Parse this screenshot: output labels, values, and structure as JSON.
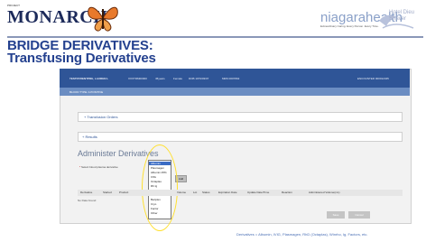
{
  "header": {
    "logo_sub": "PROJECT",
    "logo": "MONARCH",
    "partner": "niagarahealth",
    "partner_tagline": "Extraordinary Caring. Every Person. Every Time.",
    "partner2_line1": "Hotel Dieu",
    "partner2_line2": "Shaver"
  },
  "slide": {
    "title_line1": "BRIDGE DERIVATIVES:",
    "title_line2": "Transfusing Derivatives"
  },
  "patient_bar": {
    "name": "TESTPATIENTPRE, LAUREN L",
    "fields": [
      "XXXTRM00000",
      "45years",
      "Female",
      "DOB 1979/03/07",
      "MRN 0007802"
    ],
    "right": "ENCOUNTER 000012345"
  },
  "subbar": {
    "text": "BLOOD TYPE: A POSITIVE"
  },
  "sections": {
    "transfusion_orders": "+ Transfusion Orders",
    "results": "+ Results"
  },
  "admin": {
    "title": "Administer Derivatives",
    "select_label": "Select blood plasma derivative",
    "add_button": "Add",
    "options": [
      "Albumin",
      "Plasmagen",
      "Albumin 25%",
      "IVIG",
      "Octaplas",
      "Rh Ig",
      "Winrho",
      "Kcentra",
      "Beriplex",
      "Cryo",
      "Factor",
      "Other"
    ],
    "selected_index": 0
  },
  "table": {
    "columns": [
      "Derivative",
      "Started",
      "Product",
      "Volume",
      "Lot",
      "Status",
      "Expiration Date",
      "Update Date/Time",
      "Reaction",
      "Administered Volume(mL)"
    ],
    "empty_text": "No Data Found"
  },
  "footer_buttons": [
    "Save",
    "Cancel"
  ],
  "footer": {
    "text": "Derivatives = Albumin, IVIG, Plasmagen, RhD (Octaplas), Winrho, Ig, Factors, etc."
  },
  "colors": {
    "accent": "#2f5597",
    "highlight": "#ffe030",
    "title": "#24418f"
  }
}
